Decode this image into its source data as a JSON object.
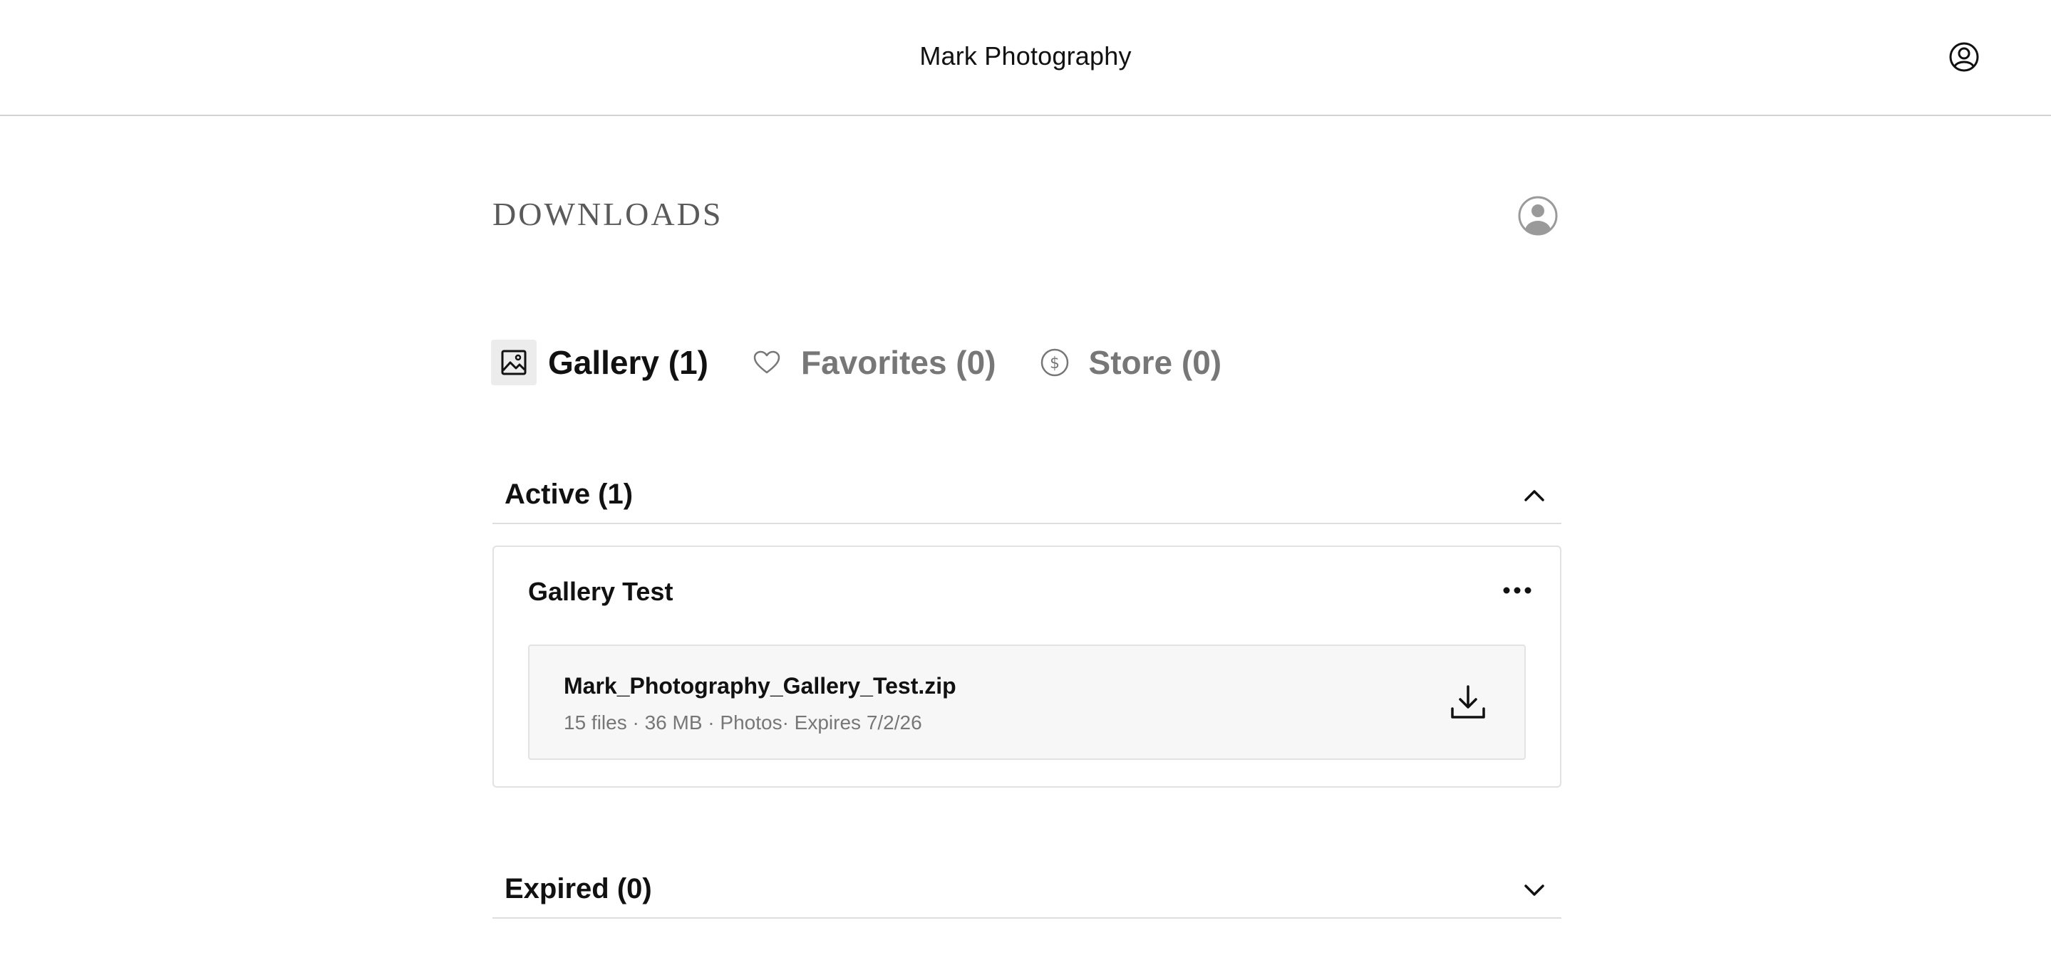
{
  "header": {
    "brand": "Mark Photography",
    "account_icon": "account-circle-icon"
  },
  "page": {
    "title": "DOWNLOADS",
    "avatar_icon": "user-avatar-icon"
  },
  "tabs": [
    {
      "label": "Gallery (1)",
      "icon": "image-icon",
      "active": true
    },
    {
      "label": "Favorites (0)",
      "icon": "heart-icon",
      "active": false
    },
    {
      "label": "Store (0)",
      "icon": "dollar-circle-icon",
      "active": false
    }
  ],
  "sections": {
    "active": {
      "title": "Active (1)",
      "expanded": true,
      "chevron_icon": "chevron-up-icon",
      "items": [
        {
          "title": "Gallery Test",
          "menu_icon": "more-horizontal-icon",
          "file": {
            "name": "Mark_Photography_Gallery_Test.zip",
            "meta": "15 files · 36 MB · Photos· Expires 7/2/26",
            "action_icon": "download-icon"
          }
        }
      ]
    },
    "expired": {
      "title": "Expired (0)",
      "expanded": false,
      "chevron_icon": "chevron-down-icon"
    }
  },
  "colors": {
    "text_primary": "#111111",
    "text_muted": "#777777",
    "title_gray": "#5a5a5a",
    "divider": "#d2d2d2",
    "file_bg": "#f7f7f7",
    "active_tab_bg": "#ececec"
  }
}
